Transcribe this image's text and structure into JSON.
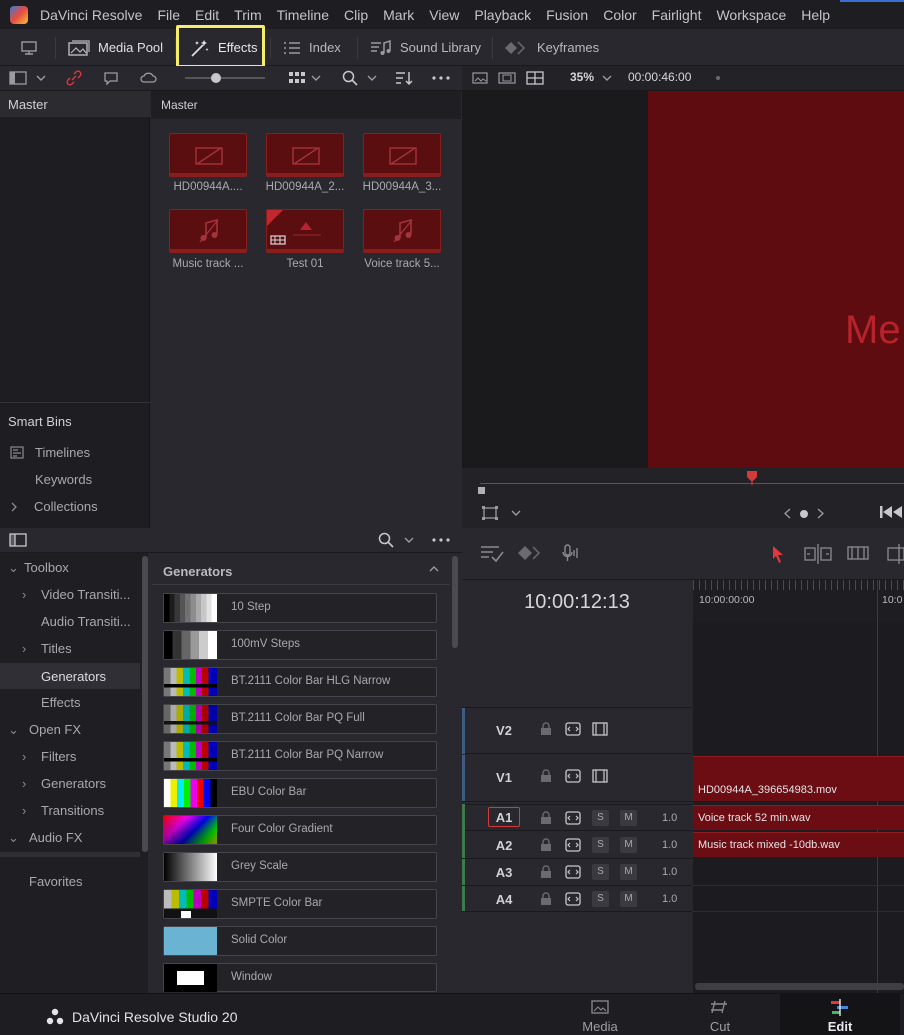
{
  "app": {
    "menu": [
      "DaVinci Resolve",
      "File",
      "Edit",
      "Trim",
      "Timeline",
      "Clip",
      "Mark",
      "View",
      "Playback",
      "Fusion",
      "Color",
      "Fairlight",
      "Workspace",
      "Help"
    ],
    "brand": "DaVinci Resolve Studio 20"
  },
  "toolbar": {
    "media_pool": "Media Pool",
    "effects": "Effects",
    "index": "Index",
    "sound_library": "Sound Library",
    "keyframes": "Keyframes"
  },
  "viewer": {
    "zoom": "35%",
    "timecode": "00:00:46:00",
    "overlay_text": "Me"
  },
  "bins": {
    "master": "Master",
    "smart_bins": "Smart Bins",
    "items": [
      "Timelines",
      "Keywords",
      "Collections"
    ]
  },
  "pool": {
    "header": "Master",
    "clips": [
      {
        "label": "HD00944A....",
        "kind": "video"
      },
      {
        "label": "HD00944A_2...",
        "kind": "video"
      },
      {
        "label": "HD00944A_3...",
        "kind": "video"
      },
      {
        "label": "Music track ...",
        "kind": "audio"
      },
      {
        "label": "Test 01",
        "kind": "timeline"
      },
      {
        "label": "Voice track 5...",
        "kind": "audio"
      }
    ]
  },
  "fx_tree": [
    {
      "label": "Toolbox",
      "level": 0,
      "chev": "down"
    },
    {
      "label": "Video Transiti...",
      "level": 1,
      "chev": "right"
    },
    {
      "label": "Audio Transiti...",
      "level": 1,
      "chev": ""
    },
    {
      "label": "Titles",
      "level": 1,
      "chev": "right"
    },
    {
      "label": "Generators",
      "level": 1,
      "chev": "",
      "selected": true
    },
    {
      "label": "Effects",
      "level": 1,
      "chev": ""
    },
    {
      "label": "Open FX",
      "level": 0,
      "chev": "down"
    },
    {
      "label": "Filters",
      "level": 1,
      "chev": "right"
    },
    {
      "label": "Generators",
      "level": 1,
      "chev": "right"
    },
    {
      "label": "Transitions",
      "level": 1,
      "chev": "right"
    },
    {
      "label": "Audio FX",
      "level": 0,
      "chev": "down"
    }
  ],
  "favorites": "Favorites",
  "generators": {
    "title": "Generators",
    "items": [
      "10 Step",
      "100mV Steps",
      "BT.2111 Color Bar HLG Narrow",
      "BT.2111 Color Bar PQ Full",
      "BT.2111 Color Bar PQ Narrow",
      "EBU Color Bar",
      "Four Color Gradient",
      "Grey Scale",
      "SMPTE Color Bar",
      "Solid Color",
      "Window"
    ]
  },
  "timeline": {
    "timecode": "10:00:12:13",
    "ruler": [
      "10:00:00:00",
      "10:0"
    ],
    "tracks": [
      {
        "name": "V2",
        "type": "video"
      },
      {
        "name": "V1",
        "type": "video",
        "clip": "HD00944A_396654983.mov"
      },
      {
        "name": "A1",
        "type": "audio",
        "vol": "1.0",
        "clip": "Voice track 52 min.wav",
        "selected": true
      },
      {
        "name": "A2",
        "type": "audio",
        "vol": "1.0",
        "clip": "Music track mixed -10db.wav"
      },
      {
        "name": "A3",
        "type": "audio",
        "vol": "1.0"
      },
      {
        "name": "A4",
        "type": "audio",
        "vol": "1.0"
      }
    ],
    "solo": "S",
    "mute": "M"
  },
  "pages": [
    "Media",
    "Cut",
    "Edit"
  ],
  "colors": {
    "accent_highlight": "#f6ee6a",
    "clip_red": "#6b0d12",
    "selected_page": "#141416"
  }
}
